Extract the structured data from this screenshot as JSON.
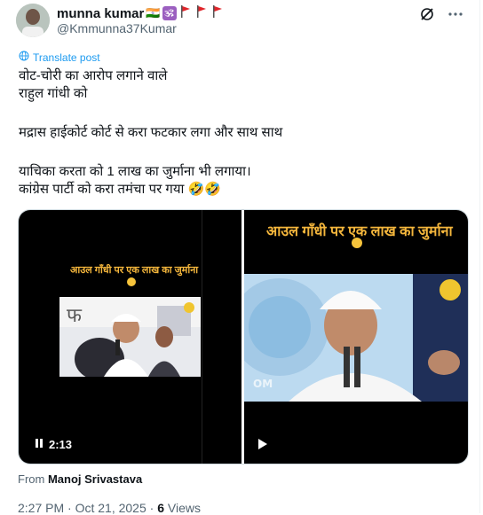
{
  "tweet": {
    "author_name": "munna kumar",
    "name_emojis": [
      "🇮🇳",
      "🕉",
      "🚩",
      "🚩",
      "🚩"
    ],
    "handle": "@Kmmunna37Kumar",
    "translate_label": "Translate post",
    "lines": [
      "वोट-चोरी का आरोप लगाने वाले",
      "राहुल गांधी को",
      "मद्रास हाईकोर्ट कोर्ट से करा फटकार लगा और साथ साथ",
      "याचिका करता को 1 लाख का जुर्माना भी लगाया।",
      "कांग्रेस पार्टी को करा तमंचा पर गया 🤣🤣"
    ],
    "media": {
      "video1_caption": "आउल गाँधी पर एक लाख का जुर्माना",
      "video1_duration": "2:13",
      "video2_caption": "आउल गाँधी पर एक लाख का जुर्माना"
    },
    "from_label": "From",
    "from_name": "Manoj Srivastava",
    "time": "2:27 PM · Oct 21, 2025 · ",
    "views_count": "6",
    "views_label": " Views"
  }
}
